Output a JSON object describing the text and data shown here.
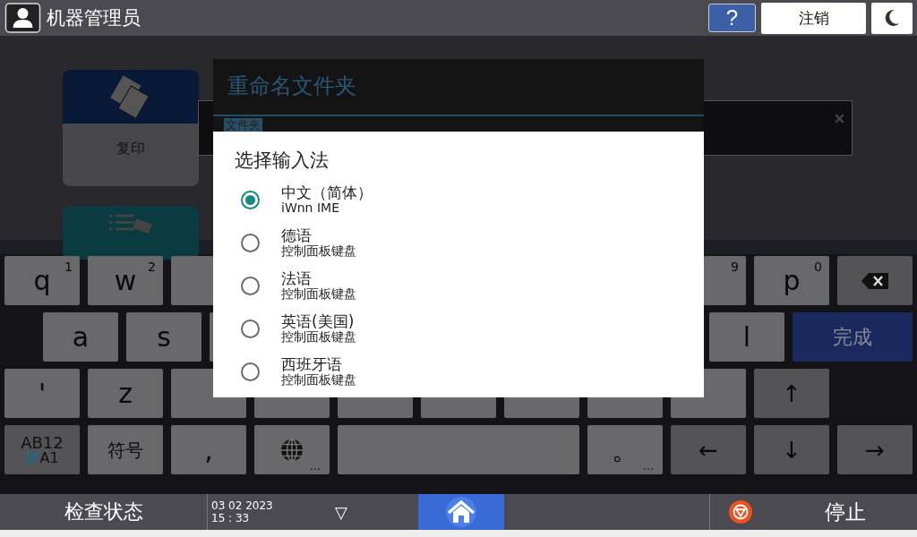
{
  "header": {
    "title": "机器管理员",
    "help_button": "?",
    "logout_button": "注销"
  },
  "home_tiles": [
    {
      "label": "复印",
      "kind": "copy"
    },
    {
      "kind": "list"
    }
  ],
  "rename_dialog": {
    "title": "重命名文件夹",
    "field_label": "文件夹"
  },
  "input_method_dialog": {
    "title": "选择输入法",
    "options": [
      {
        "name": "中文（简体）",
        "subtitle": "iWnn IME",
        "selected": true
      },
      {
        "name": "德语",
        "subtitle": "控制面板键盘",
        "selected": false
      },
      {
        "name": "法语",
        "subtitle": "控制面板键盘",
        "selected": false
      },
      {
        "name": "英语(美国)",
        "subtitle": "控制面板键盘",
        "selected": false
      },
      {
        "name": "西班牙语",
        "subtitle": "控制面板键盘",
        "selected": false
      }
    ]
  },
  "keyboard": {
    "rows": [
      [
        {
          "kind": "char",
          "label": "q",
          "sup": "1"
        },
        {
          "kind": "char",
          "label": "w",
          "sup": "2"
        },
        {
          "kind": "blank"
        },
        {
          "kind": "blank"
        },
        {
          "kind": "blank"
        },
        {
          "kind": "blank"
        },
        {
          "kind": "blank"
        },
        {
          "kind": "blank"
        },
        {
          "kind": "char",
          "sup": "9"
        },
        {
          "kind": "char",
          "label": "p",
          "sup": "0"
        },
        {
          "kind": "backspace"
        }
      ],
      [
        {
          "kind": "char",
          "label": "a"
        },
        {
          "kind": "char",
          "label": "s"
        },
        {
          "kind": "blank"
        },
        {
          "kind": "blank"
        },
        {
          "kind": "blank"
        },
        {
          "kind": "blank"
        },
        {
          "kind": "blank"
        },
        {
          "kind": "blank"
        },
        {
          "kind": "char",
          "label": "l"
        },
        {
          "kind": "done",
          "label": "完成"
        }
      ],
      [
        {
          "kind": "char",
          "label": "'"
        },
        {
          "kind": "char",
          "label": "z"
        },
        {
          "kind": "blank"
        },
        {
          "kind": "blank"
        },
        {
          "kind": "blank"
        },
        {
          "kind": "blank"
        },
        {
          "kind": "blank"
        },
        {
          "kind": "blank"
        },
        {
          "kind": "blank"
        },
        {
          "kind": "arrow",
          "label": "↑"
        }
      ],
      [
        {
          "kind": "mode",
          "top": "AB12",
          "accent": "拼",
          "bottom": "A1"
        },
        {
          "kind": "char",
          "label": "符号"
        },
        {
          "kind": "char",
          "label": ","
        },
        {
          "kind": "globe",
          "sub": "…"
        },
        {
          "kind": "space"
        },
        {
          "kind": "char",
          "label": "。",
          "sub": "…"
        },
        {
          "kind": "arrow",
          "label": "←"
        },
        {
          "kind": "arrow",
          "label": "↓"
        },
        {
          "kind": "arrow",
          "label": "→"
        }
      ]
    ]
  },
  "status_bar": {
    "check_status": "检查状态",
    "date": "03 02 2023",
    "time": "15 : 33",
    "menu_caret": "▽",
    "stop": "停止"
  }
}
